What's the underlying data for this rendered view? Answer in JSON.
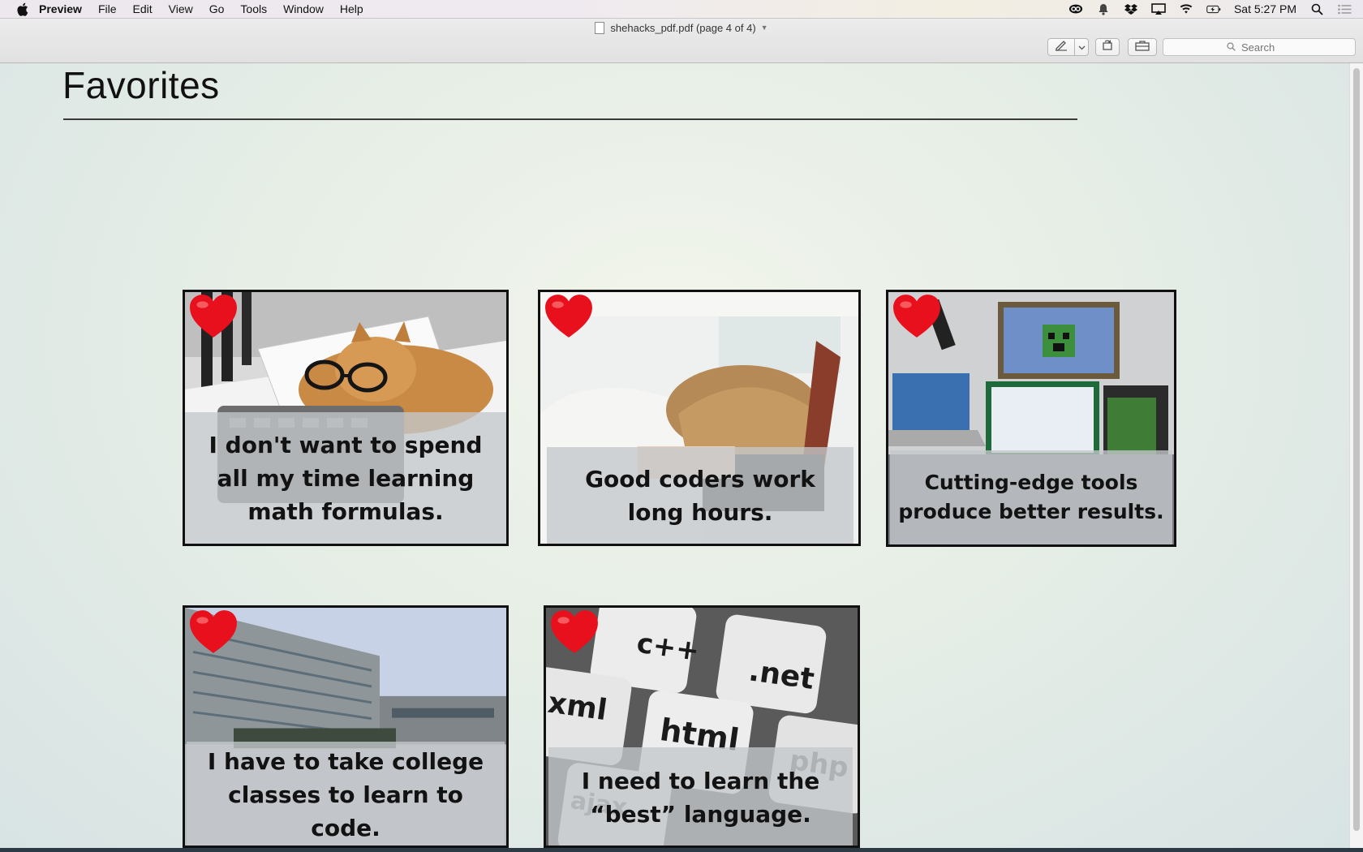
{
  "menubar": {
    "app_name": "Preview",
    "items": [
      "File",
      "Edit",
      "View",
      "Go",
      "Tools",
      "Window",
      "Help"
    ],
    "clock": "Sat 5:27 PM",
    "status_icons": [
      "creative-cloud-icon",
      "notification-bell-icon",
      "dropbox-icon",
      "airplay-icon",
      "wifi-icon",
      "battery-charging-icon",
      "spotlight-search-icon",
      "notification-center-icon"
    ]
  },
  "window": {
    "title": "shehacks_pdf.pdf (page 4 of 4)",
    "search_placeholder": "Search"
  },
  "page": {
    "title": "Favorites",
    "cards": [
      {
        "caption": "I don't want to spend all my time learning math formulas.",
        "image": "cat-wearing-glasses-on-papers"
      },
      {
        "caption": "Good coders work long hours.",
        "image": "woman-asleep-on-laptop"
      },
      {
        "caption": "Cutting-edge tools produce better results.",
        "image": "desk-with-laptop-and-monitors"
      },
      {
        "caption": "I have to take college classes to learn to code.",
        "image": "college-campus-building"
      },
      {
        "caption": "I need to learn the “best” language.",
        "image": "keyboard-keys-programming-languages"
      }
    ],
    "keyboard_keys": [
      "c++",
      ".net",
      "xml",
      "html",
      "php",
      "ajax"
    ]
  },
  "colors": {
    "heart": "#e8101c",
    "caption_band": "#c4c8cc",
    "card_border": "#111111"
  }
}
